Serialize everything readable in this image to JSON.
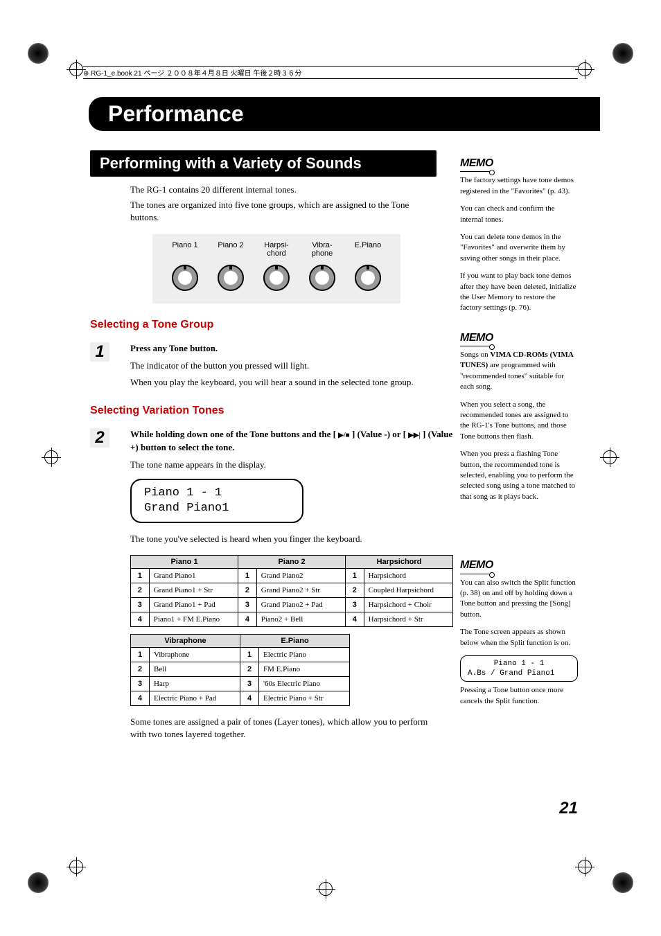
{
  "header_meta": "RG-1_e.book 21 ページ ２００８年４月８日 火曜日 午後２時３６分",
  "chapter_title": "Performance",
  "section_title": "Performing with a Variety of Sounds",
  "intro_line1": "The RG-1 contains 20 different internal tones.",
  "intro_line2": "The tones are organized into five tone groups, which are assigned to the Tone buttons.",
  "tone_labels": [
    "Piano 1",
    "Piano 2",
    "Harpsi-chord",
    "Vibra-phone",
    "E.Piano"
  ],
  "sub_heading1": "Selecting a Tone Group",
  "step1": {
    "num": "1",
    "strong": "Press any Tone button.",
    "p1": "The indicator of the button you pressed will light.",
    "p2": "When you play the keyboard, you will hear a sound in the selected tone group."
  },
  "sub_heading2": "Selecting Variation Tones",
  "step2": {
    "num": "2",
    "strong_a": "While holding down one of the Tone buttons and the [ ",
    "strong_b": " ] (Value -) or [ ",
    "strong_c": " ] (Value +) button to select the tone.",
    "p1": "The tone name appears in the display."
  },
  "lcd": {
    "line1": "Piano 1 - 1",
    "line2": "Grand Piano1"
  },
  "post_lcd": "The tone you've selected is heard when you finger the keyboard.",
  "table1": {
    "headers": [
      "Piano 1",
      "Piano 2",
      "Harpsichord"
    ],
    "rows": [
      [
        "1",
        "Grand Piano1",
        "1",
        "Grand Piano2",
        "1",
        "Harpsichord"
      ],
      [
        "2",
        "Grand Piano1 + Str",
        "2",
        "Grand Piano2 + Str",
        "2",
        "Coupled Harpsichord"
      ],
      [
        "3",
        "Grand Piano1 + Pad",
        "3",
        "Grand Piano2 + Pad",
        "3",
        "Harpsichord + Choir"
      ],
      [
        "4",
        "Piano1 + FM E.Piano",
        "4",
        "Piano2 + Bell",
        "4",
        "Harpsichord + Str"
      ]
    ]
  },
  "table2": {
    "headers": [
      "Vibraphone",
      "E.Piano"
    ],
    "rows": [
      [
        "1",
        "Vibraphone",
        "1",
        "Electric Piano"
      ],
      [
        "2",
        "Bell",
        "2",
        "FM E.Piano"
      ],
      [
        "3",
        "Harp",
        "3",
        "'60s Electric Piano"
      ],
      [
        "4",
        "Electric Piano + Pad",
        "4",
        "Electric Piano + Str"
      ]
    ]
  },
  "footnote": "Some tones are assigned a pair of tones (Layer tones), which allow you to perform with two tones layered together.",
  "memo1": {
    "label": "MEMO",
    "p1": "The factory settings have tone demos registered in the \"Favorites\" (p. 43).",
    "p2": "You can check and confirm the internal tones.",
    "p3": "You can delete tone demos in the \"Favorites\" and overwrite them by saving other songs in their place.",
    "p4": "If you want to play back tone demos after they have been deleted, initialize the User Memory to restore the factory settings (p. 76)."
  },
  "memo2": {
    "label": "MEMO",
    "p1a": "Songs on ",
    "p1b": "VIMA CD-ROMs (VIMA TUNES)",
    "p1c": " are programmed with \"recommended tones\" suitable for each song.",
    "p2": "When you select a song, the recommended tones are assigned to the RG-1's Tone buttons, and those Tone buttons then flash.",
    "p3": "When you press a flashing Tone button, the recommended tone is selected, enabling you to perform the selected song using a tone matched to that song as it plays back."
  },
  "memo3": {
    "label": "MEMO",
    "p1": "You can also switch the Split function (p. 38) on and off by holding down a Tone button and pressing the [Song] button.",
    "p2": "The Tone screen appears as shown below when the Split function is on.",
    "lcd_line1": "Piano 1 - 1",
    "lcd_line2": "A.Bs / Grand Piano1",
    "p3": " Pressing a Tone button once more cancels the Split function."
  },
  "page_num": "21"
}
